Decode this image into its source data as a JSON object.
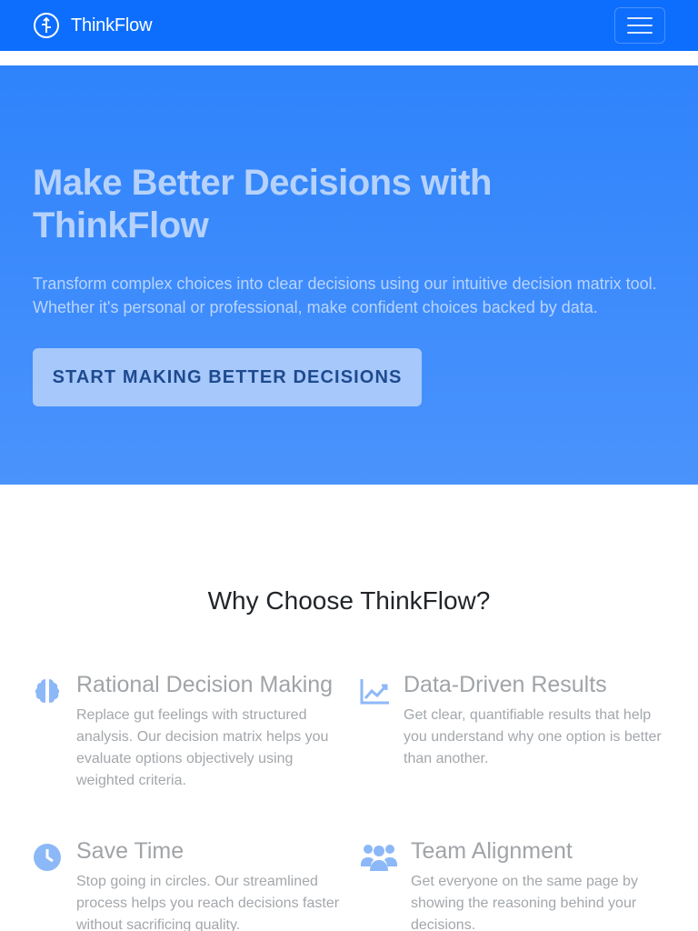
{
  "navbar": {
    "brand_name": "ThinkFlow",
    "brand_icon": "split-arrows-icon",
    "menu_icon": "hamburger-icon",
    "background": "#0d6efd"
  },
  "hero": {
    "title": "Make Better Decisions with ThinkFlow",
    "lead": "Transform complex choices into clear decisions using our intuitive decision matrix tool. Whether it's personal or professional, make confident choices backed by data.",
    "cta_label": "START MAKING BETTER DECISIONS"
  },
  "features": {
    "title": "Why Choose ThinkFlow?",
    "items": [
      {
        "icon": "brain-icon",
        "heading": "Rational Decision Making",
        "text": "Replace gut feelings with structured analysis. Our decision matrix helps you evaluate options objectively using weighted criteria."
      },
      {
        "icon": "line-chart-icon",
        "heading": "Data-Driven Results",
        "text": "Get clear, quantifiable results that help you understand why one option is better than another."
      },
      {
        "icon": "clock-icon",
        "heading": "Save Time",
        "text": "Stop going in circles. Our streamlined process helps you reach decisions faster without sacrificing quality."
      },
      {
        "icon": "users-icon",
        "heading": "Team Alignment",
        "text": "Get everyone on the same page by showing the reasoning behind your decisions."
      }
    ]
  },
  "colors": {
    "primary": "#0d6efd",
    "hero_gradient_start": "#2f83fb",
    "hero_gradient_end": "#4a93fc",
    "icon_blue": "#8cb8f8"
  }
}
